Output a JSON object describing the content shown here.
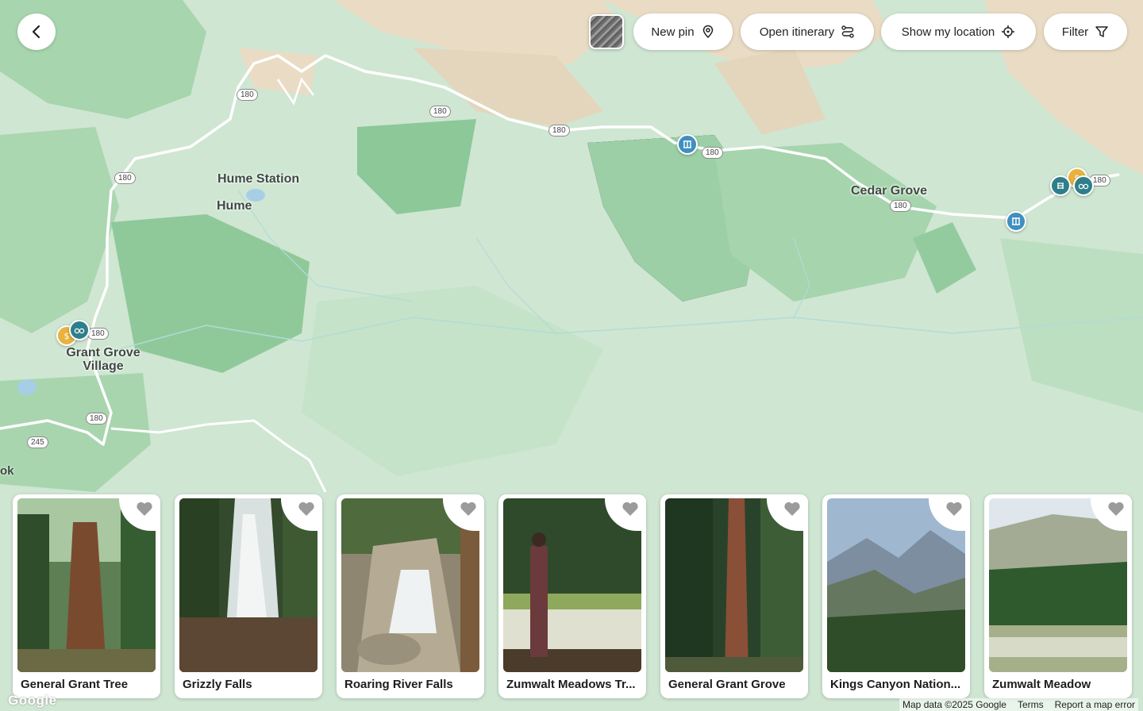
{
  "toolbar": {
    "back_icon": "chevron-left-icon",
    "new_pin": "New pin",
    "open_itinerary": "Open itinerary",
    "show_location": "Show my location",
    "filter": "Filter"
  },
  "map": {
    "places": [
      "Hume Station",
      "Hume",
      "Grant Grove Village",
      "Cedar Grove"
    ],
    "edge_label": "ok",
    "routes": [
      "180",
      "180",
      "180",
      "180",
      "180",
      "180",
      "180",
      "180",
      "180",
      "245"
    ],
    "colors": {
      "forest": "#9fd0a6",
      "meadow": "#cfe6d2",
      "rock": "#eadcc4",
      "road": "#ffffff",
      "water": "#a6cfe6"
    }
  },
  "pins": [
    {
      "icon": "waterfall-icon",
      "color": "#3f8fc0"
    },
    {
      "icon": "waterfall-icon",
      "color": "#3f8fc0"
    },
    {
      "icon": "binoculars-icon",
      "color": "#2f7f8a"
    },
    {
      "icon": "dollar-icon",
      "color": "#e8b23c"
    },
    {
      "icon": "binoculars-icon",
      "color": "#2f7f8a"
    },
    {
      "icon": "lodging-icon",
      "color": "#2f7f8a"
    },
    {
      "icon": "dollar-icon",
      "color": "#e8b23c"
    }
  ],
  "cards": [
    {
      "title": "General Grant Tree"
    },
    {
      "title": "Grizzly Falls"
    },
    {
      "title": "Roaring River Falls"
    },
    {
      "title": "Zumwalt Meadows Tr..."
    },
    {
      "title": "General Grant Grove"
    },
    {
      "title": "Kings Canyon Nation..."
    },
    {
      "title": "Zumwalt Meadow"
    }
  ],
  "footer": {
    "map_data": "Map data ©2025 Google",
    "terms": "Terms",
    "report": "Report a map error",
    "logo": "Google"
  }
}
